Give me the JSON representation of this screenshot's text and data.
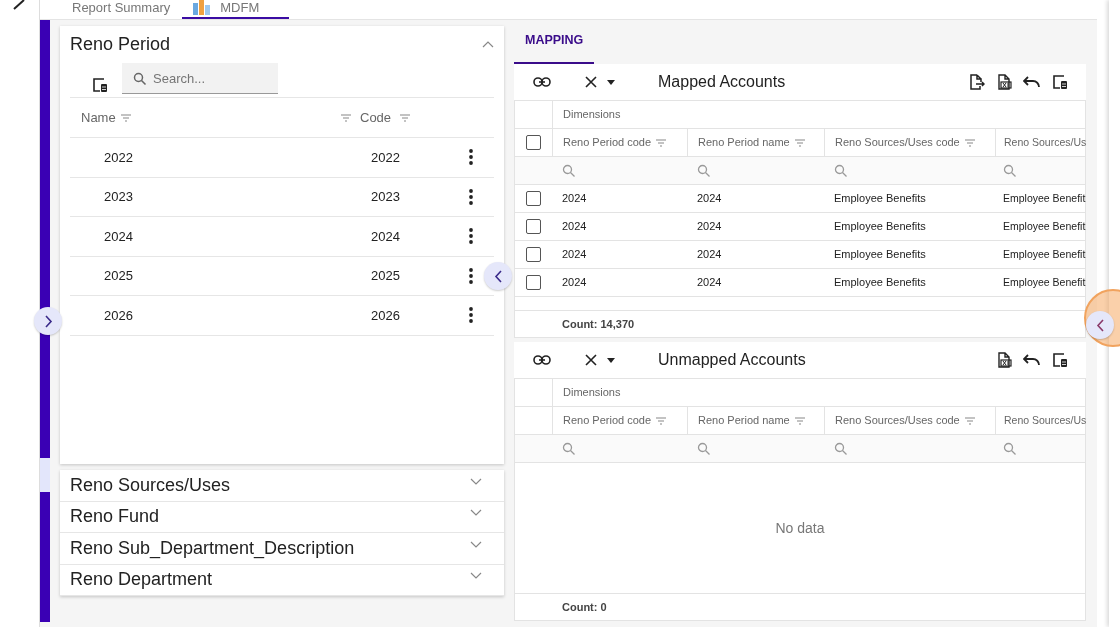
{
  "top_tabs": [
    {
      "label": "Report Summary",
      "selected": false,
      "icon": false
    },
    {
      "label": "MDFM",
      "selected": true,
      "icon": true
    }
  ],
  "left_panel": {
    "title": "Reno Period",
    "expanded": true,
    "search": {
      "placeholder": "Search..."
    },
    "columns": [
      "Name",
      "Code"
    ],
    "rows": [
      {
        "name": "2022",
        "code": "2022"
      },
      {
        "name": "2023",
        "code": "2023"
      },
      {
        "name": "2024",
        "code": "2024"
      },
      {
        "name": "2025",
        "code": "2025"
      },
      {
        "name": "2026",
        "code": "2026"
      }
    ]
  },
  "sections": [
    {
      "title": "Reno Sources/Uses",
      "expanded": false
    },
    {
      "title": "Reno Fund",
      "expanded": false
    },
    {
      "title": "Reno Sub_Department_Description",
      "expanded": false
    },
    {
      "title": "Reno Department",
      "expanded": false
    }
  ],
  "right_tabs": [
    {
      "label": "MAPPING",
      "selected": true
    }
  ],
  "grids": [
    {
      "title": "Mapped Accounts",
      "tools": [
        {
          "kind": "export"
        },
        {
          "kind": "excel"
        },
        {
          "kind": "undo"
        },
        {
          "kind": "layout"
        }
      ],
      "select_all": {
        "checked": false
      },
      "group_header": "Dimensions",
      "columns": [
        "Reno Period code",
        "Reno Period name",
        "Reno Sources/Uses code",
        "Reno Sources/Us"
      ],
      "rows": [
        {
          "checked": false,
          "cells": [
            "2024",
            "2024",
            "Employee Benefits",
            "Employee Benefit"
          ]
        },
        {
          "checked": false,
          "cells": [
            "2024",
            "2024",
            "Employee Benefits",
            "Employee Benefit"
          ]
        },
        {
          "checked": false,
          "cells": [
            "2024",
            "2024",
            "Employee Benefits",
            "Employee Benefit"
          ]
        },
        {
          "checked": false,
          "cells": [
            "2024",
            "2024",
            "Employee Benefits",
            "Employee Benefit"
          ]
        }
      ],
      "count": "Count: 14,370"
    },
    {
      "title": "Unmapped Accounts",
      "tools": [
        {
          "kind": "excel"
        },
        {
          "kind": "undo"
        },
        {
          "kind": "layout"
        }
      ],
      "group_header": "Dimensions",
      "columns": [
        "Reno Period code",
        "Reno Period name",
        "Reno Sources/Uses code",
        "Reno Sources/Us"
      ],
      "empty_text": "No data",
      "count": "Count: 0"
    }
  ]
}
